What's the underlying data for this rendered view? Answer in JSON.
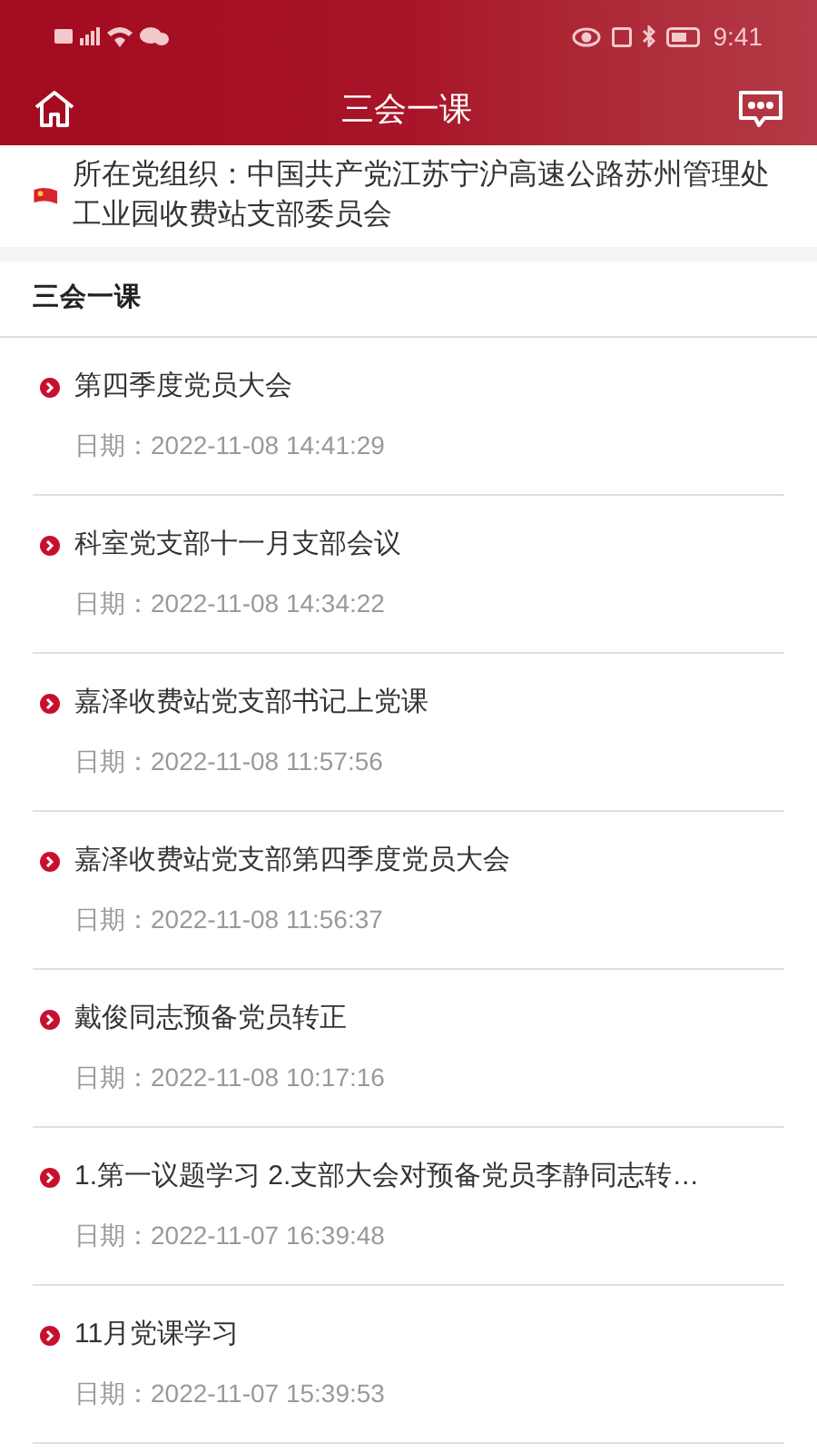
{
  "status_bar": {
    "time": "9:41"
  },
  "header": {
    "title": "三会一课"
  },
  "organization": {
    "text": "所在党组织：中国共产党江苏宁沪高速公路苏州管理处工业园收费站支部委员会"
  },
  "section": {
    "title": "三会一课"
  },
  "items": [
    {
      "title": "第四季度党员大会",
      "date": "日期：2022-11-08 14:41:29"
    },
    {
      "title": "科室党支部十一月支部会议",
      "date": "日期：2022-11-08 14:34:22"
    },
    {
      "title": "嘉泽收费站党支部书记上党课",
      "date": "日期：2022-11-08 11:57:56"
    },
    {
      "title": "嘉泽收费站党支部第四季度党员大会",
      "date": "日期：2022-11-08 11:56:37"
    },
    {
      "title": "戴俊同志预备党员转正",
      "date": "日期：2022-11-08 10:17:16"
    },
    {
      "title": "1.第一议题学习 2.支部大会对预备党员李静同志转…",
      "date": "日期：2022-11-07 16:39:48"
    },
    {
      "title": "11月党课学习",
      "date": "日期：2022-11-07 15:39:53"
    }
  ]
}
